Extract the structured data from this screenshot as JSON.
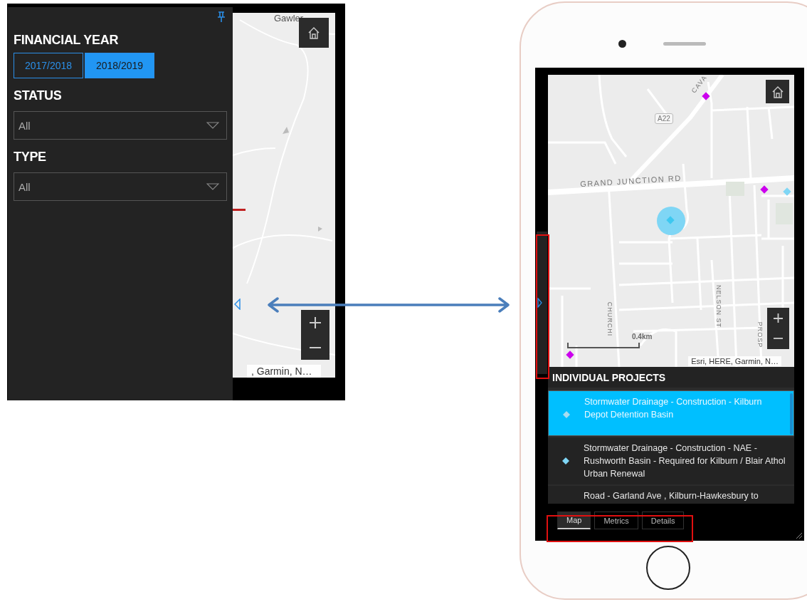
{
  "dashboard": {
    "filters": [
      {
        "kind": "buttons",
        "label": "FINANCIAL YEAR",
        "options": [
          {
            "label": "2017/2018",
            "selected": false
          },
          {
            "label": "2018/2019",
            "selected": true
          }
        ]
      },
      {
        "kind": "select",
        "label": "STATUS",
        "value": "All"
      },
      {
        "kind": "select",
        "label": "TYPE",
        "value": "All"
      }
    ],
    "map": {
      "place_label": "Gawler",
      "attribution": ", Garmin, N…"
    }
  },
  "phone": {
    "map": {
      "labels": [
        {
          "text": "CAVA"
        },
        {
          "text": "A22"
        },
        {
          "text": "GRAND JUNCTION RD"
        },
        {
          "text": "NELSON ST"
        },
        {
          "text": "CHURCHI"
        },
        {
          "text": "PROSP"
        }
      ],
      "markers": [
        {
          "color": "#cc00ee",
          "selected": false
        },
        {
          "color": "#cc00ee",
          "selected": false
        },
        {
          "color": "#7fd6f5",
          "selected": false
        },
        {
          "color": "#3cc8f0",
          "selected": true
        },
        {
          "color": "#cc00ee",
          "selected": false
        }
      ],
      "scale": "0.4km",
      "attribution": "Esri, HERE, Garmin, N…"
    },
    "list": {
      "title": "INDIVIDUAL PROJECTS",
      "items": [
        {
          "text": "Stormwater Drainage - Construction - Kilburn Depot Detention Basin",
          "selected": true
        },
        {
          "text": "Stormwater Drainage - Construction - NAE - Rushworth Basin - Required for Kilburn / Blair Athol Urban Renewal",
          "selected": false
        },
        {
          "text": "Road - Garland Ave , Kilburn-Hawkesbury to",
          "selected": false
        }
      ]
    },
    "tabs": [
      {
        "label": "Map",
        "selected": true
      },
      {
        "label": "Metrics",
        "selected": false
      },
      {
        "label": "Details",
        "selected": false
      }
    ]
  }
}
